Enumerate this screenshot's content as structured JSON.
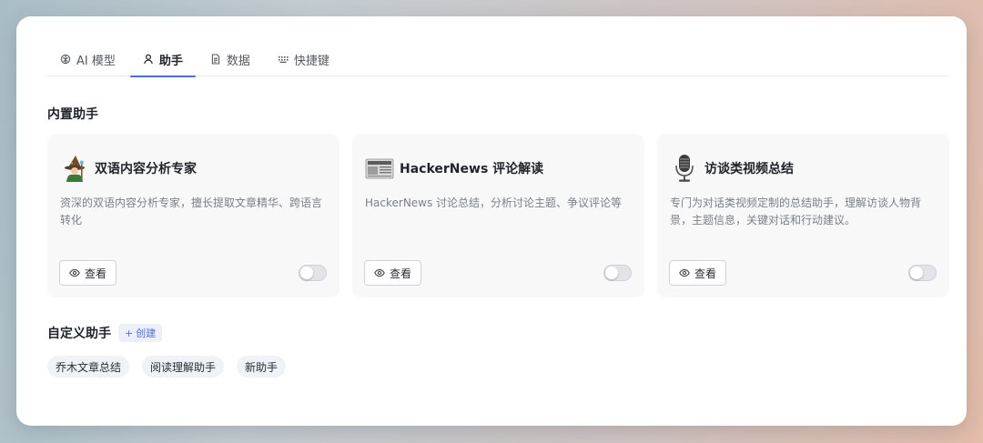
{
  "tabs": [
    {
      "label": "AI 模型",
      "icon": "brain-icon"
    },
    {
      "label": "助手",
      "icon": "user-icon"
    },
    {
      "label": "数据",
      "icon": "document-icon"
    },
    {
      "label": "快捷键",
      "icon": "keyboard-icon"
    }
  ],
  "active_tab": "助手",
  "builtin": {
    "title": "内置助手",
    "view_label": "查看",
    "cards": [
      {
        "title": "双语内容分析专家",
        "desc": "资深的双语内容分析专家，擅长提取文章精华、跨语言转化",
        "icon": "wizard-icon",
        "enabled": false
      },
      {
        "title": "HackerNews 评论解读",
        "desc": "HackerNews 讨论总结，分析讨论主题、争议评论等",
        "icon": "newspaper-icon",
        "enabled": false
      },
      {
        "title": "访谈类视频总结",
        "desc": "专门为对话类视频定制的总结助手，理解访谈人物背景，主题信息，关键对话和行动建议。",
        "icon": "microphone-icon",
        "enabled": false
      }
    ]
  },
  "custom": {
    "title": "自定义助手",
    "create_label": "创建",
    "items": [
      "乔木文章总结",
      "阅读理解助手",
      "新助手"
    ]
  },
  "colors": {
    "accent": "#4f6bd8",
    "card_bg": "#f8f8f9",
    "chip_bg": "#eff3f8"
  }
}
